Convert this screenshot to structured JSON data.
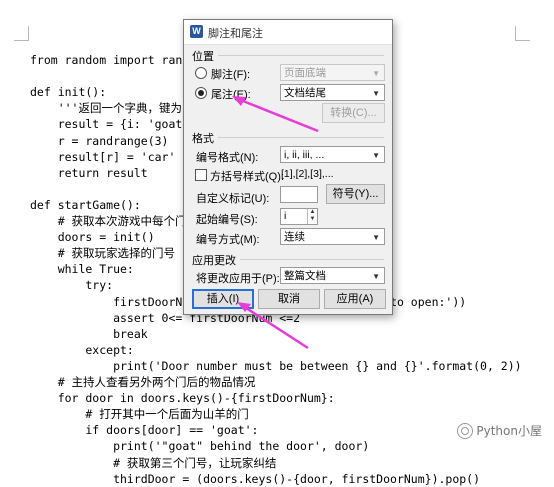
{
  "code_lines": [
    "from random import randint, randrange",
    "",
    "def init():",
    "    '''返回一个字典，键为门号，值为门后物品'''",
    "    result = {i: 'goat' for i in range(3)}",
    "    r = randrange(3)",
    "    result[r] = 'car'",
    "    return result",
    "",
    "def startGame():",
    "    # 获取本次游戏中每个门后的物品",
    "    doors = init()",
    "    # 获取玩家选择的门号",
    "    while True:",
    "        try:",
    "            firstDoorNum = int(input('Choose a door to open:'))",
    "            assert 0<= firstDoorNum <=2",
    "            break",
    "        except:",
    "            print('Door number must be between {} and {}'.format(0, 2))",
    "    # 主持人查看另外两个门后的物品情况",
    "    for door in doors.keys()-{firstDoorNum}:",
    "        # 打开其中一个后面为山羊的门",
    "        if doors[door] == 'goat':",
    "            print('\"goat\" behind the door', door)",
    "            # 获取第三个门号，让玩家纠结",
    "            thirdDoor = (doors.keys()-{door, firstDoorNum}).pop()"
  ],
  "watermark": "Python小屋",
  "dialog": {
    "title": "脚注和尾注",
    "app_icon_letter": "W",
    "position_section": "位置",
    "footnote_label": "脚注(F):",
    "footnote_value": "页面底端",
    "endnote_label": "尾注(E):",
    "endnote_value": "文档结尾",
    "convert_button": "转换(C)...",
    "format_section": "格式",
    "number_format_label": "编号格式(N):",
    "number_format_value": "i, ii, iii, ...",
    "bracket_label": "方括号样式(Q):",
    "bracket_value": "[1],[2],[3],...",
    "custom_mark_label": "自定义标记(U):",
    "custom_mark_value": "",
    "symbol_button": "符号(Y)...",
    "start_at_label": "起始编号(S):",
    "start_at_value": "i",
    "numbering_label": "编号方式(M):",
    "numbering_value": "连续",
    "apply_section": "应用更改",
    "apply_to_label": "将更改应用于(P):",
    "apply_to_value": "整篇文档",
    "insert_button": "插入(I)",
    "cancel_button": "取消",
    "apply_button": "应用(A)"
  },
  "colors": {
    "annotation_arrow": "#e53dd6",
    "default_button_border": "#2a6fd6",
    "app_icon": "#2b579a"
  }
}
